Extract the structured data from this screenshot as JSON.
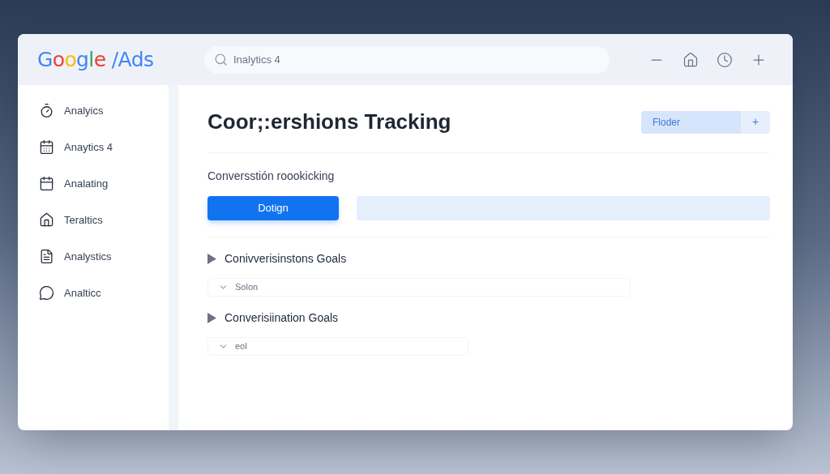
{
  "header": {
    "logo": "Google /Ads",
    "search": {
      "placeholder": "Inalytics 4"
    }
  },
  "sidebar": {
    "items": [
      {
        "label": "Analyics"
      },
      {
        "label": "Anaytics 4"
      },
      {
        "label": "Analating"
      },
      {
        "label": "Teraltics"
      },
      {
        "label": "Analystics"
      },
      {
        "label": "Analticc"
      }
    ]
  },
  "main": {
    "title": "Coor;:ershions Tracking",
    "folder_button": "Floder",
    "add_button": "+",
    "subtitle": "Conversstión roookicking",
    "primary_button": "Dotign",
    "sections": [
      {
        "title": "Conivverisinstons Goals",
        "expanded": false,
        "field_placeholder": "Solon"
      },
      {
        "title": "Converisiination Goals",
        "expanded": false,
        "field_placeholder": "eol"
      }
    ]
  }
}
